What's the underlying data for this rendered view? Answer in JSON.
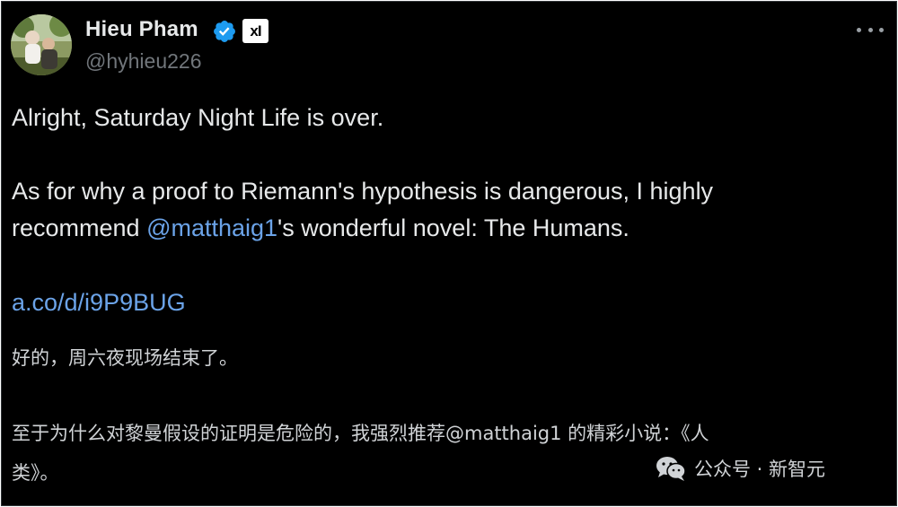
{
  "author": {
    "display_name": "Hieu Pham",
    "handle": "@hyhieu226",
    "affiliation_badge": "xI",
    "verified_icon": "verified-badge-icon",
    "verified_color": "#1d9bf0"
  },
  "menu": {
    "icon": "more-options-icon"
  },
  "tweet": {
    "line1": "Alright, Saturday Night Life is over.",
    "line2": "As for why a proof to Riemann's hypothesis is dangerous, I highly",
    "line3_before": "recommend ",
    "line3_mention": "@matthaig1",
    "line3_after": "'s wonderful novel: The Humans.",
    "link": "a.co/d/i9P9BUG"
  },
  "translation": {
    "line1": "好的，周六夜现场结束了。",
    "line2": "至于为什么对黎曼假设的证明是危险的，我强烈推荐@matthaig1 的精彩小说：《人",
    "line3": "类》。"
  },
  "watermark": {
    "icon": "wechat-icon",
    "text": "公众号 · 新智元"
  },
  "colors": {
    "background": "#000000",
    "text": "#e7e9ea",
    "secondary": "#71767b",
    "link": "#6ba3e8"
  }
}
